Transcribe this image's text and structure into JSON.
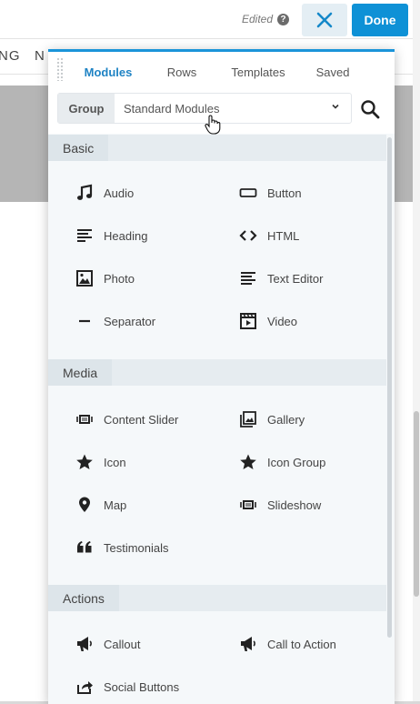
{
  "background": {
    "nav_left": "NG",
    "nav_right": "N"
  },
  "topbar": {
    "edited_label": "Edited",
    "help_icon": "?",
    "close_icon": "✕",
    "done_label": "Done"
  },
  "panel": {
    "tabs": [
      {
        "label": "Modules",
        "active": true
      },
      {
        "label": "Rows",
        "active": false
      },
      {
        "label": "Templates",
        "active": false
      },
      {
        "label": "Saved",
        "active": false
      }
    ],
    "group_label": "Group",
    "group_selected": "Standard Modules",
    "sections": [
      {
        "title": "Basic",
        "modules": [
          {
            "label": "Audio",
            "icon": "music-note-icon"
          },
          {
            "label": "Button",
            "icon": "button-rectangle-icon"
          },
          {
            "label": "Heading",
            "icon": "heading-lines-icon"
          },
          {
            "label": "HTML",
            "icon": "code-brackets-icon"
          },
          {
            "label": "Photo",
            "icon": "photo-icon"
          },
          {
            "label": "Text Editor",
            "icon": "text-lines-icon"
          },
          {
            "label": "Separator",
            "icon": "separator-icon"
          },
          {
            "label": "Video",
            "icon": "video-clapper-icon"
          }
        ]
      },
      {
        "title": "Media",
        "modules": [
          {
            "label": "Content Slider",
            "icon": "slider-icon"
          },
          {
            "label": "Gallery",
            "icon": "gallery-icon"
          },
          {
            "label": "Icon",
            "icon": "star-icon"
          },
          {
            "label": "Icon Group",
            "icon": "star-icon"
          },
          {
            "label": "Map",
            "icon": "map-pin-icon"
          },
          {
            "label": "Slideshow",
            "icon": "slider-icon"
          },
          {
            "label": "Testimonials",
            "icon": "quote-icon"
          }
        ]
      },
      {
        "title": "Actions",
        "modules": [
          {
            "label": "Callout",
            "icon": "megaphone-icon"
          },
          {
            "label": "Call to Action",
            "icon": "megaphone-icon"
          },
          {
            "label": "Social Buttons",
            "icon": "share-icon"
          }
        ]
      }
    ]
  },
  "colors": {
    "accent": "#1a94d9",
    "done_button": "#0e91d6",
    "active_tab": "#1f83c4"
  }
}
